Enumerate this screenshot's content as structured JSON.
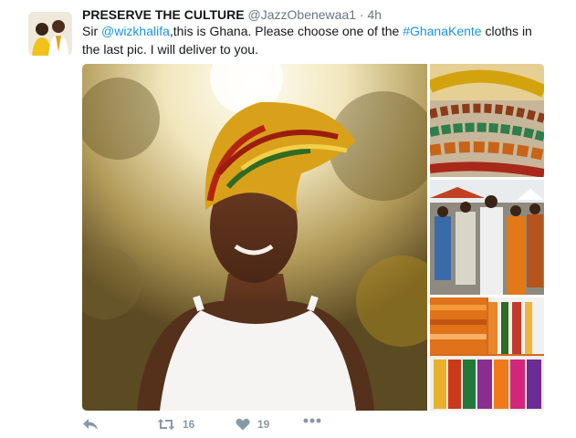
{
  "tweet": {
    "author_name": "PRESERVE THE CULTURE",
    "author_handle": "@JazzObenewaa1",
    "separator": "·",
    "time": "4h",
    "text_parts": {
      "p1": "Sir ",
      "mention": "@wizkhalifa",
      "p2": ",this is Ghana. Please choose one of the ",
      "hashtag": "#GhanaKente",
      "p3": " cloths in the last pic. I will deliver to you."
    }
  },
  "actions": {
    "retweet_count": "16",
    "like_count": "19"
  },
  "colors": {
    "link": "#1b95e0",
    "muted": "#657786",
    "action_icon": "#8899a6"
  },
  "icons": [
    "reply-icon",
    "retweet-icon",
    "like-icon",
    "more-icon"
  ]
}
